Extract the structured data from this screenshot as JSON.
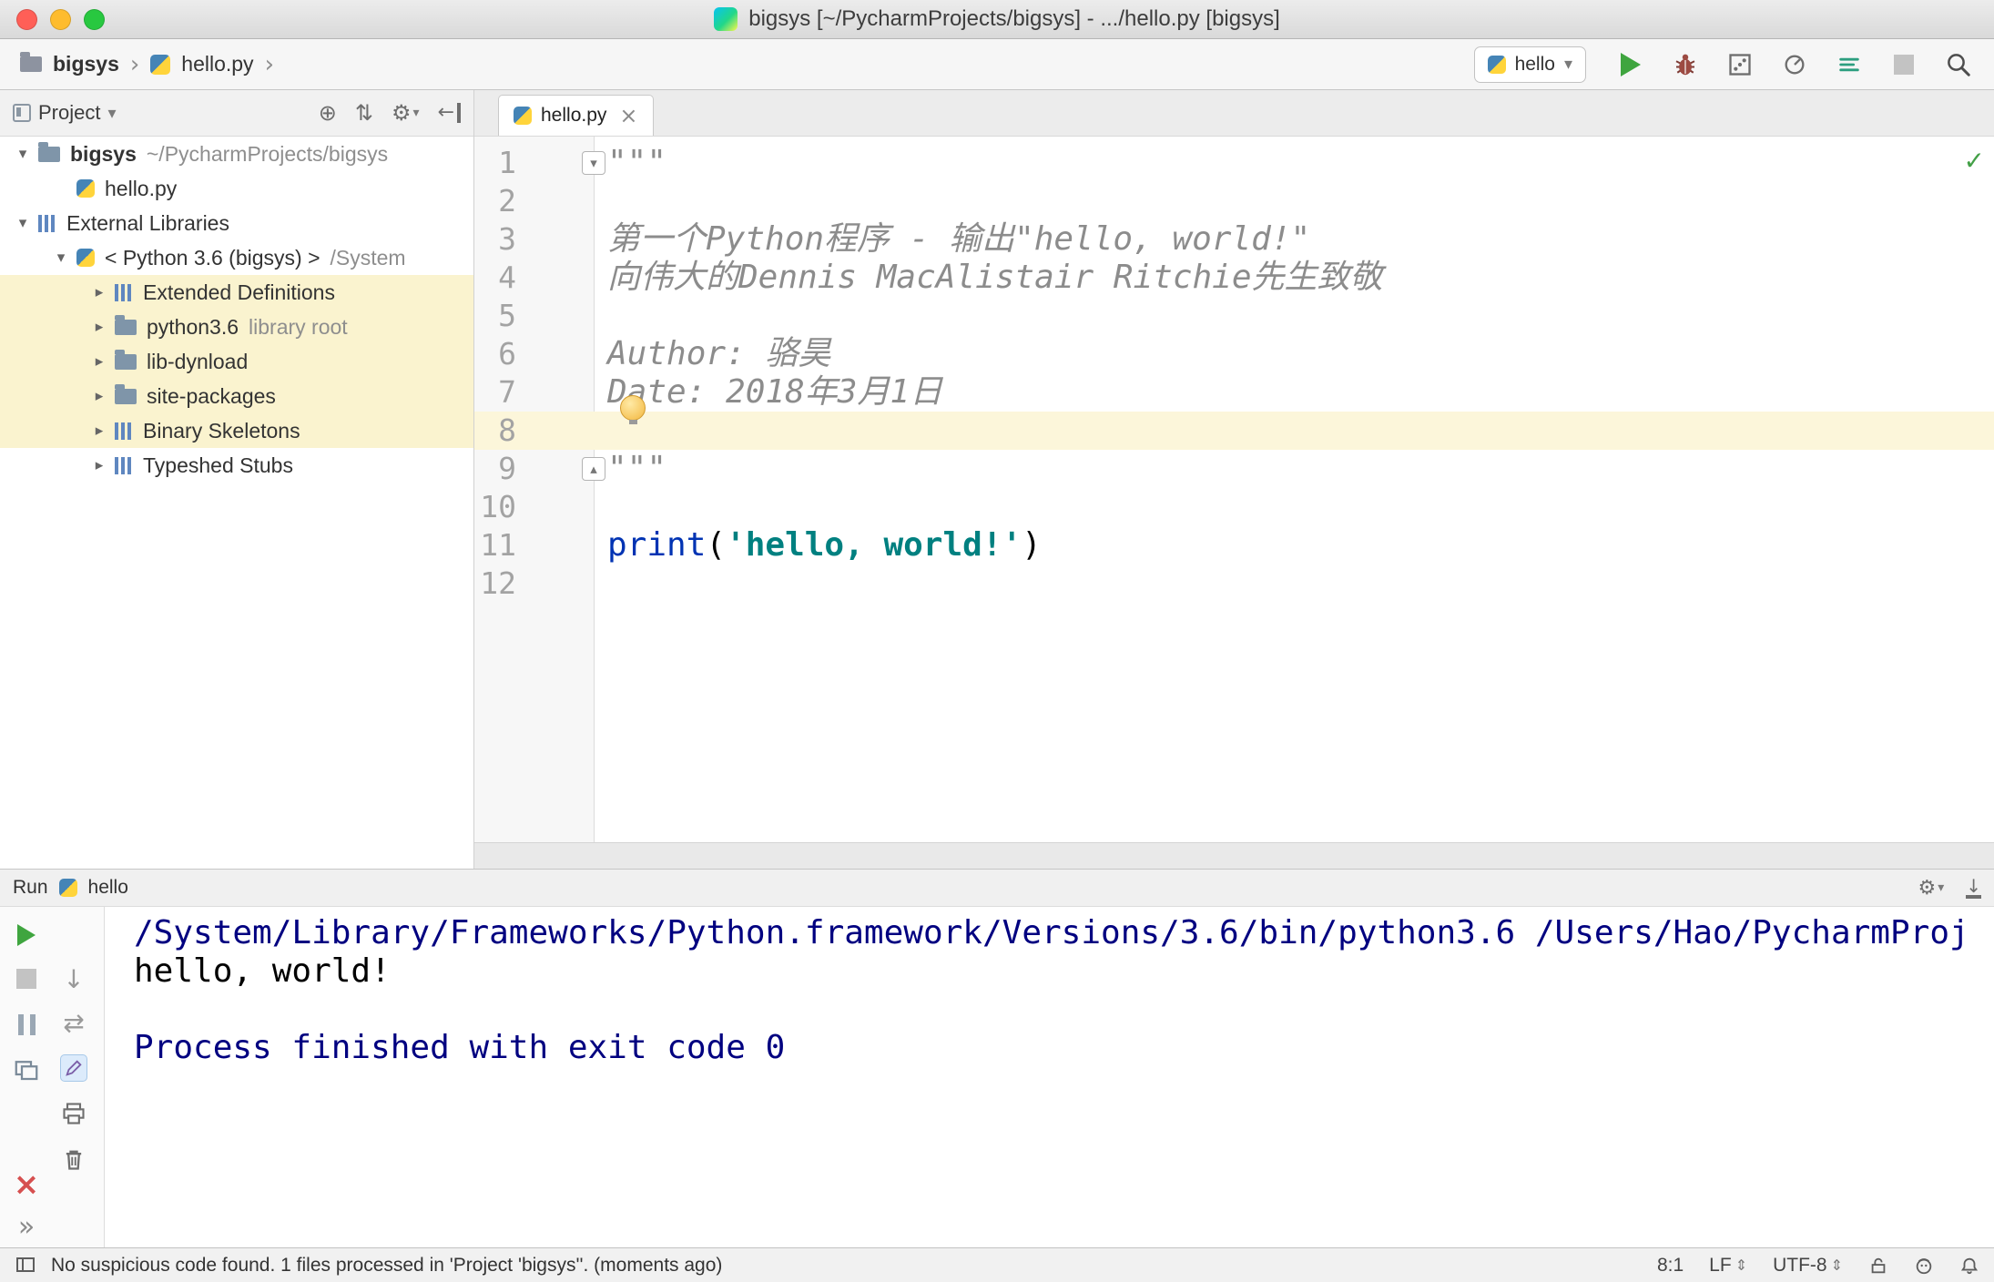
{
  "colors": {
    "caret_row": "#fcf6da",
    "tree_highlight": "#faf3cf",
    "console_system": "#000080",
    "string": "#008080",
    "builtin": "#0033b3",
    "docstring": "#8c8c8c",
    "run_green": "#3fa53f",
    "error_red": "#d64f4f"
  },
  "icons": {
    "chevron_right": "›",
    "chevron_down": "▾",
    "arrow_expanded": "▾",
    "arrow_collapsed": "▸",
    "fold_top": "▾",
    "fold_bottom": "▴",
    "gear": "⚙",
    "locate": "⊕",
    "collapse_all": "⇅",
    "hide_left": "←",
    "close": "×",
    "run_more": "»",
    "down_arrow": "↓",
    "swap": "⇄",
    "updown": "⇕",
    "check": "✓"
  },
  "titlebar": {
    "title": "bigsys [~/PycharmProjects/bigsys] - .../hello.py [bigsys]"
  },
  "navbar": {
    "breadcrumbs": [
      "bigsys",
      "hello.py"
    ],
    "run_config": "hello"
  },
  "project_panel": {
    "title": "Project",
    "tree": [
      {
        "label": "bigsys",
        "note": "~/PycharmProjects/bigsys",
        "level": 0,
        "arrow": "down",
        "icon": "folder",
        "bold": true,
        "highlight": false
      },
      {
        "label": "hello.py",
        "level": 1,
        "arrow": null,
        "icon": "python",
        "bold": false,
        "highlight": false
      },
      {
        "label": "External Libraries",
        "level": 0,
        "arrow": "down",
        "icon": "library",
        "bold": false,
        "highlight": false
      },
      {
        "label": "< Python 3.6 (bigsys) >",
        "note": "/System",
        "level": 1,
        "arrow": "down",
        "icon": "python",
        "bold": false,
        "highlight": false
      },
      {
        "label": "Extended Definitions",
        "level": 2,
        "arrow": "right",
        "icon": "library",
        "bold": false,
        "highlight": true
      },
      {
        "label": "python3.6",
        "note": "library root",
        "level": 2,
        "arrow": "right",
        "icon": "folder",
        "bold": false,
        "highlight": true
      },
      {
        "label": "lib-dynload",
        "level": 2,
        "arrow": "right",
        "icon": "folder",
        "bold": false,
        "highlight": true
      },
      {
        "label": "site-packages",
        "level": 2,
        "arrow": "right",
        "icon": "folder",
        "bold": false,
        "highlight": true
      },
      {
        "label": "Binary Skeletons",
        "level": 2,
        "arrow": "right",
        "icon": "library",
        "bold": false,
        "highlight": true
      },
      {
        "label": "Typeshed Stubs",
        "level": 2,
        "arrow": "right",
        "icon": "library",
        "bold": false,
        "highlight": false
      }
    ]
  },
  "editor": {
    "tab": "hello.py",
    "lines": [
      {
        "n": 1,
        "fold": "top",
        "segments": [
          {
            "t": "\"\"\"",
            "c": "docstring"
          }
        ]
      },
      {
        "n": 2,
        "segments": []
      },
      {
        "n": 3,
        "segments": [
          {
            "t": "第一个Python程序 - 输出\"hello, world!\"",
            "c": "docstring"
          }
        ]
      },
      {
        "n": 4,
        "segments": [
          {
            "t": "向伟大的Dennis MacAlistair Ritchie先生致敬",
            "c": "docstring"
          }
        ]
      },
      {
        "n": 5,
        "segments": []
      },
      {
        "n": 6,
        "segments": [
          {
            "t": "Author: 骆昊",
            "c": "docstring"
          }
        ]
      },
      {
        "n": 7,
        "bulb": true,
        "segments": [
          {
            "t": "Date: 2018年3月1日",
            "c": "docstring"
          }
        ]
      },
      {
        "n": 8,
        "current": true,
        "segments": []
      },
      {
        "n": 9,
        "fold": "bottom",
        "segments": [
          {
            "t": "\"\"\"",
            "c": "docstring"
          }
        ]
      },
      {
        "n": 10,
        "segments": []
      },
      {
        "n": 11,
        "segments": [
          {
            "t": "print",
            "c": "builtin"
          },
          {
            "t": "(",
            "c": "plain"
          },
          {
            "t": "'hello, world!'",
            "c": "string"
          },
          {
            "t": ")",
            "c": "plain"
          }
        ]
      },
      {
        "n": 12,
        "segments": []
      }
    ]
  },
  "run_panel": {
    "title": "Run",
    "config": "hello",
    "console": [
      {
        "text": "/System/Library/Frameworks/Python.framework/Versions/3.6/bin/python3.6 /Users/Hao/PycharmProj",
        "kind": "system"
      },
      {
        "text": "hello, world!",
        "kind": "stdout"
      },
      {
        "text": "",
        "kind": "stdout"
      },
      {
        "text": "Process finished with exit code 0",
        "kind": "system"
      }
    ]
  },
  "statusbar": {
    "message": "No suspicious code found. 1 files processed in 'Project 'bigsys''. (moments ago)",
    "caret": "8:1",
    "line_ending": "LF",
    "encoding": "UTF-8"
  }
}
